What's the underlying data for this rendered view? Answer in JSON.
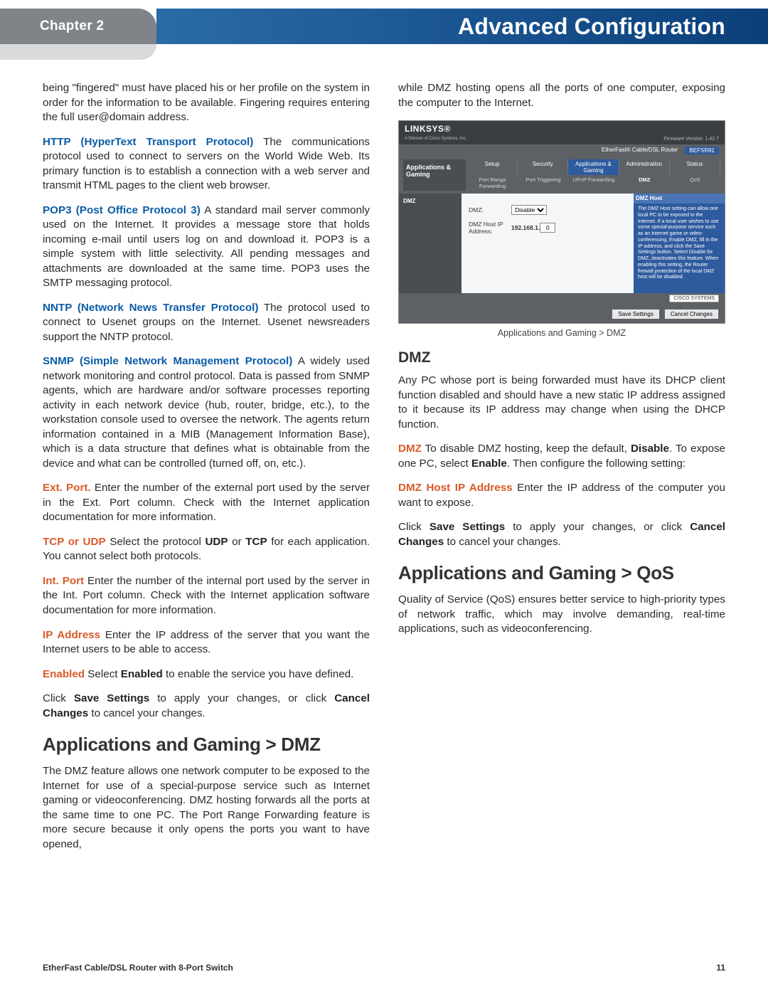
{
  "header": {
    "chapter": "Chapter 2",
    "title": "Advanced Configuration"
  },
  "left": {
    "p_finger": "being \"fingered\" must have placed his or her profile on the system in order for the information to be available. Fingering requires entering the full user@domain address.",
    "http_term": "HTTP (HyperText Transport Protocol)",
    "http_body": " The communications protocol used to connect to servers on the World Wide Web. Its primary function is to establish a connection with a web server and transmit HTML pages to the client web browser.",
    "pop3_term": "POP3 (Post Office Protocol 3)",
    "pop3_body": " A standard mail server commonly used on the Internet. It provides a message store that holds incoming e-mail until users log on and download it. POP3 is a simple system with little selectivity. All pending messages and attachments are downloaded at the same time. POP3 uses the SMTP messaging protocol.",
    "nntp_term": "NNTP (Network News Transfer Protocol)",
    "nntp_body": " The protocol used to connect to Usenet groups on the Internet. Usenet newsreaders support the NNTP protocol.",
    "snmp_term": "SNMP (Simple Network Management Protocol)",
    "snmp_body": " A widely used network monitoring and control protocol. Data is passed from SNMP agents, which are hardware and/or software processes reporting activity in each network device (hub, router, bridge, etc.), to the workstation console used to oversee the network. The agents return information contained in a MIB (Management Information Base), which is a data structure that defines what is obtainable from the device and what can be controlled (turned off, on, etc.).",
    "extport_term": "Ext. Port.",
    "extport_body": "  Enter the number of the external port used by the server in the Ext. Port column. Check with the Internet application documentation for more information.",
    "tcpudp_term": "TCP or UDP",
    "tcpudp_body_a": " Select the protocol ",
    "tcpudp_udp": "UDP",
    "tcpudp_or": " or ",
    "tcpudp_tcp": "TCP",
    "tcpudp_body_b": " for each application. You cannot select both protocols.",
    "intport_term": "Int. Port",
    "intport_body": " Enter the number of the internal port used by the server in the Int. Port column. Check with the Internet application software documentation for more information.",
    "ipaddr_term": "IP Address",
    "ipaddr_body": "  Enter the IP address of the server that you want the Internet users to be able to access.",
    "enabled_term": "Enabled",
    "enabled_body_a": "  Select ",
    "enabled_b": "Enabled",
    "enabled_body_b": " to enable the service you have defined.",
    "save_a": "Click ",
    "save_s": "Save Settings",
    "save_b": " to apply your changes, or click ",
    "save_c": "Cancel Changes",
    "save_d": " to cancel your changes.",
    "h2_dmz": "Applications and Gaming > DMZ",
    "dmz_intro": "The DMZ feature allows one network computer to be exposed to the Internet for use of a special-purpose service such as Internet gaming or videoconferencing. DMZ hosting forwards all the ports at the same time to one PC. The Port Range Forwarding feature is more secure because it only opens the ports you want to have opened,"
  },
  "right": {
    "dmz_cont": "while DMZ hosting opens all the ports of one computer, exposing the computer to the Internet.",
    "caption": "Applications and Gaming > DMZ",
    "h3_dmz": "DMZ",
    "dmz_p1": "Any PC whose port is being forwarded must have its DHCP client function disabled and should have a new static IP address assigned to it because its IP address may change when using the DHCP function.",
    "dmz_term": "DMZ",
    "dmz_body_a": "  To disable DMZ hosting, keep the default, ",
    "dmz_disable": "Disable",
    "dmz_body_b": ". To expose one PC, select ",
    "dmz_enable": "Enable",
    "dmz_body_c": ". Then configure the following setting:",
    "dmzhost_term": "DMZ Host IP Address",
    "dmzhost_body": " Enter the IP address of the computer you want to expose.",
    "save_a": "Click ",
    "save_s": "Save Settings",
    "save_b": " to apply your changes, or click ",
    "save_c": "Cancel Changes",
    "save_d": " to cancel your changes.",
    "h2_qos": "Applications and Gaming > QoS",
    "qos_p": "Quality of Service (QoS) ensures better service to high-priority types of network traffic, which may involve demanding, real-time applications, such as videoconferencing."
  },
  "screenshot": {
    "brand": "LINKSYS®",
    "brand_sub": "A Division of Cisco Systems, Inc.",
    "fw": "Firmware Version: 1.42.7",
    "model_label": "EtherFast® Cable/DSL Router",
    "model": "BEFSR81",
    "section": "Applications & Gaming",
    "tabs1": [
      "Setup",
      "Security",
      "Applications & Gaming",
      "Administration",
      "Status"
    ],
    "tabs2": [
      "Port Range Forwarding",
      "Port Triggering",
      "UPnP Forwarding",
      "DMZ",
      "QoS"
    ],
    "side": "DMZ",
    "row1_label": "DMZ:",
    "row1_value": "Disable",
    "row2_label": "DMZ Host IP Address:",
    "row2_prefix": "192.168.1.",
    "row2_value": "0",
    "help_h": "DMZ Host",
    "help_t": "The DMZ Host setting can allow one local PC to be exposed to the Internet. If a local user wishes to use some special-purpose service such as an Internet game or video-conferencing, Enable DMZ, fill in the IP address, and click the Save Settings button. Select Disable for DMZ, deactivates this feature. When enabling this setting, the Router firewall protection of the local DMZ host will be disabled.",
    "btn_save": "Save Settings",
    "btn_cancel": "Cancel Changes",
    "cisco": "CISCO SYSTEMS"
  },
  "footer": {
    "product": "EtherFast Cable/DSL Router with 8-Port Switch",
    "page": "11"
  }
}
